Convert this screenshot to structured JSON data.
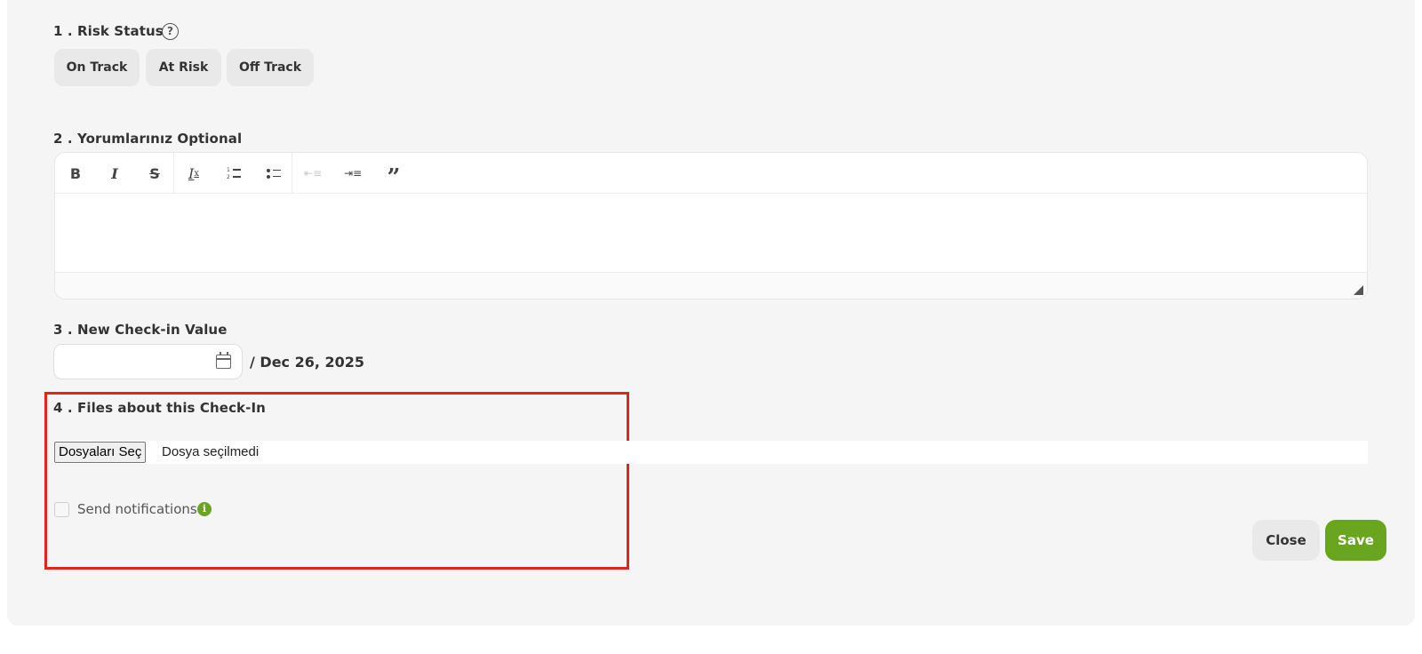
{
  "section1": {
    "label": "1 . Risk Status",
    "help_icon": "question-circle-icon",
    "options": [
      "On Track",
      "At Risk",
      "Off Track"
    ]
  },
  "section2": {
    "label": "2 . Yorumlarınız Optional",
    "toolbar": [
      "bold-icon",
      "italic-icon",
      "strikethrough-icon",
      "clear-format-icon",
      "ordered-list-icon",
      "bullet-list-icon",
      "outdent-icon",
      "indent-icon",
      "blockquote-icon"
    ],
    "value": ""
  },
  "section3": {
    "label": "3 . New Check-in Value",
    "value": "",
    "target": "/ Dec 26, 2025"
  },
  "section4": {
    "label": "4 . Files about this Check-In",
    "file_button": "Dosyaları Seç",
    "file_status": "Dosya seçilmedi"
  },
  "notifications": {
    "label": "Send notifications",
    "checked": false,
    "info_icon": "info-icon"
  },
  "actions": {
    "close": "Close",
    "save": "Save"
  },
  "colors": {
    "accent": "#6aa51f",
    "highlight": "#e0251b",
    "panel": "#f5f5f5"
  }
}
